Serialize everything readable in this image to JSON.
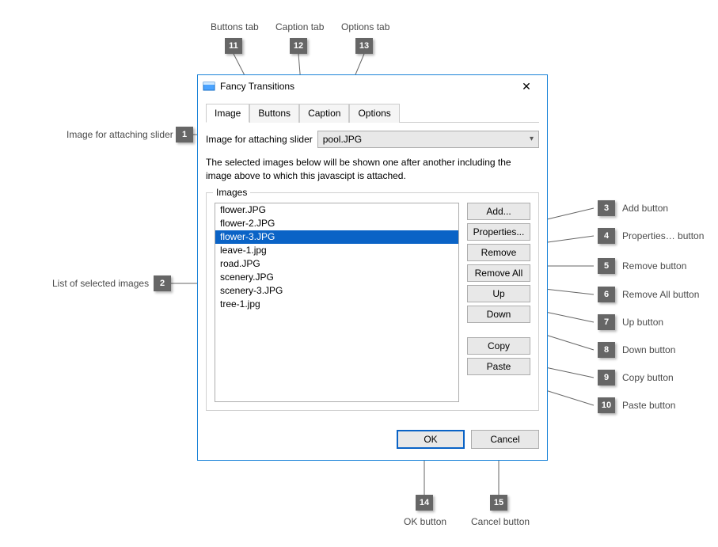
{
  "window": {
    "title": "Fancy Transitions",
    "close_glyph": "✕"
  },
  "tabs": {
    "image": "Image",
    "buttons": "Buttons",
    "caption": "Caption",
    "options": "Options"
  },
  "attach": {
    "label": "Image for attaching slider",
    "value": "pool.JPG"
  },
  "info": "The selected images below will be shown one after another including the image above to which this javascipt is attached.",
  "images_group": {
    "legend": "Images",
    "items": [
      "flower.JPG",
      "flower-2.JPG",
      "flower-3.JPG",
      "leave-1.jpg",
      "road.JPG",
      "scenery.JPG",
      "scenery-3.JPG",
      "tree-1.jpg"
    ],
    "selected_index": 2
  },
  "side_buttons": {
    "add": "Add...",
    "properties": "Properties...",
    "remove": "Remove",
    "remove_all": "Remove All",
    "up": "Up",
    "down": "Down",
    "copy": "Copy",
    "paste": "Paste"
  },
  "footer": {
    "ok": "OK",
    "cancel": "Cancel"
  },
  "callouts": {
    "c1": {
      "num": "1",
      "label": "Image for attaching slider"
    },
    "c2": {
      "num": "2",
      "label": "List of selected images"
    },
    "c3": {
      "num": "3",
      "label": "Add button"
    },
    "c4": {
      "num": "4",
      "label": "Properties… button"
    },
    "c5": {
      "num": "5",
      "label": "Remove button"
    },
    "c6": {
      "num": "6",
      "label": "Remove All button"
    },
    "c7": {
      "num": "7",
      "label": "Up button"
    },
    "c8": {
      "num": "8",
      "label": "Down button"
    },
    "c9": {
      "num": "9",
      "label": "Copy button"
    },
    "c10": {
      "num": "10",
      "label": "Paste button"
    },
    "c11": {
      "num": "11",
      "label": "Buttons tab"
    },
    "c12": {
      "num": "12",
      "label": "Caption tab"
    },
    "c13": {
      "num": "13",
      "label": "Options tab"
    },
    "c14": {
      "num": "14",
      "label": "OK button"
    },
    "c15": {
      "num": "15",
      "label": "Cancel button"
    }
  }
}
